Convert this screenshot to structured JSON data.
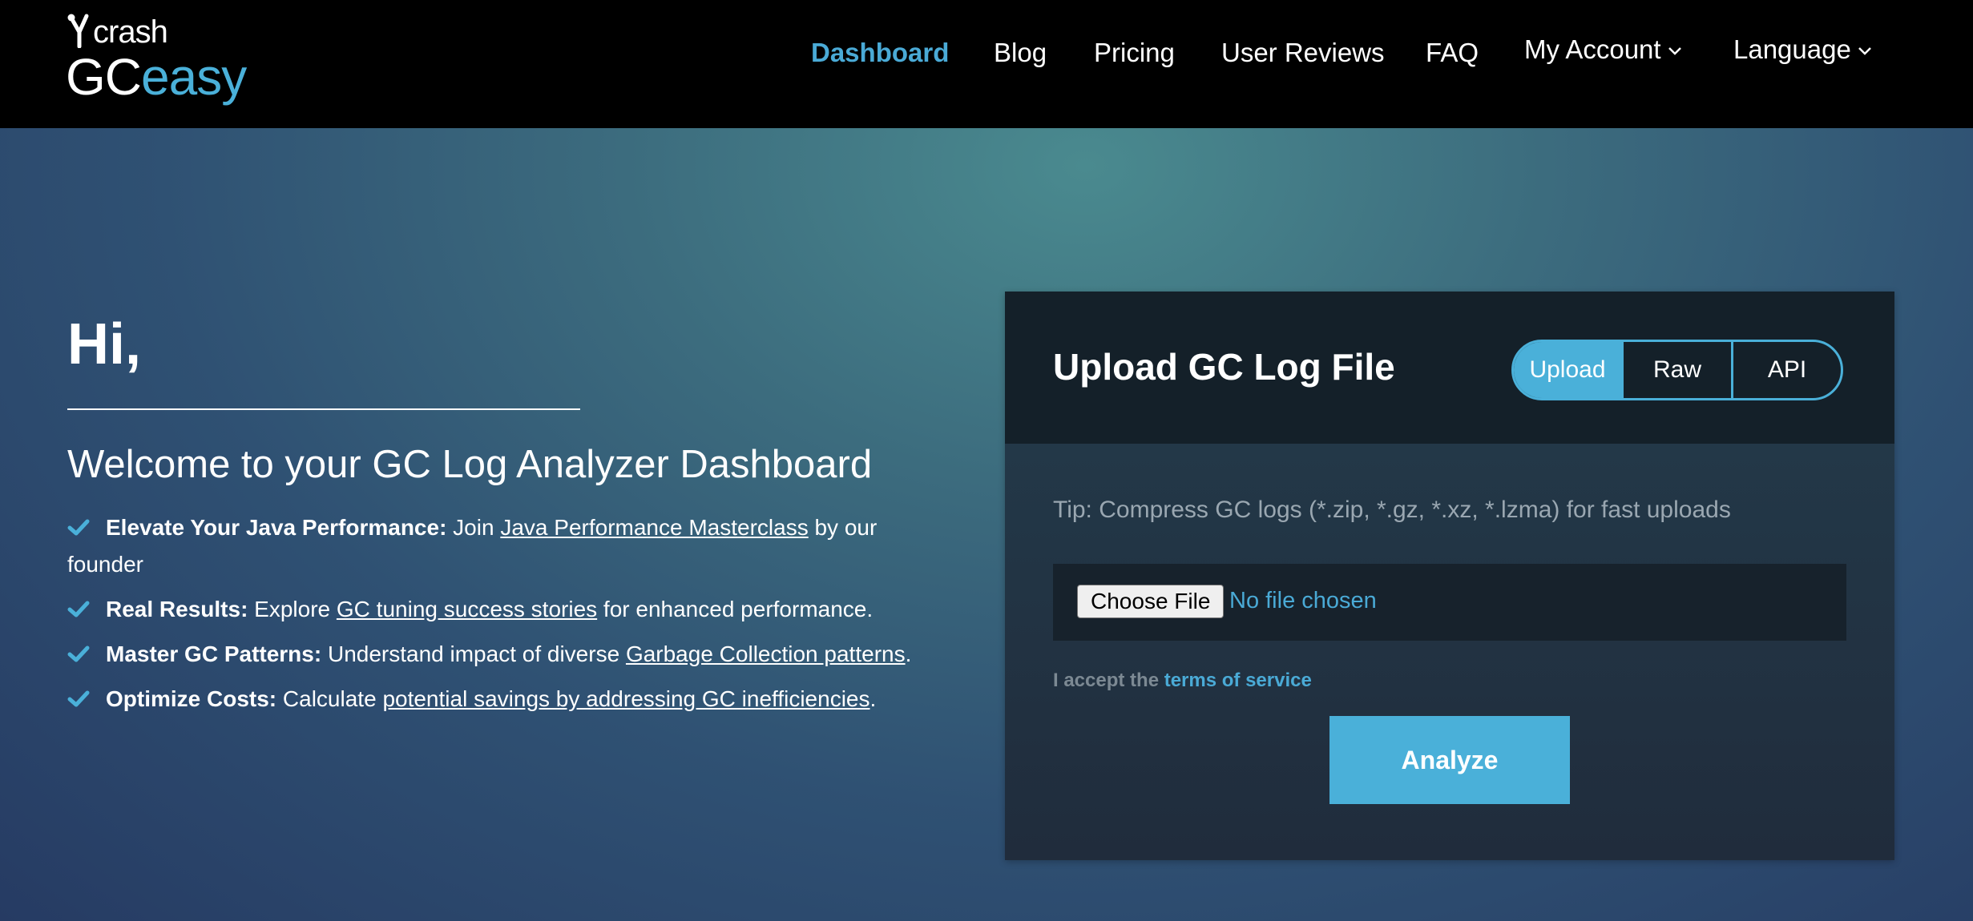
{
  "brand": {
    "top": "crash",
    "main_gc": "GC",
    "main_easy": "easy",
    "accent_color": "#4ab0d9"
  },
  "nav": {
    "items": [
      {
        "label": "Dashboard",
        "active": true
      },
      {
        "label": "Blog"
      },
      {
        "label": "Pricing"
      },
      {
        "label": "User Reviews"
      },
      {
        "label": "FAQ"
      },
      {
        "label": "My Account",
        "dropdown": true
      },
      {
        "label": "Language",
        "dropdown": true
      }
    ]
  },
  "hero": {
    "greeting": "Hi,",
    "welcome": "Welcome to your GC Log Analyzer Dashboard",
    "features": [
      {
        "bold": "Elevate Your Java Performance:",
        "before": " Join ",
        "link": "Java Performance Masterclass",
        "after": " by our",
        "after2": "founder"
      },
      {
        "bold": "Real Results:",
        "before": " Explore ",
        "link": "GC tuning success stories",
        "after": " for enhanced performance."
      },
      {
        "bold": "Master GC Patterns:",
        "before": " Understand impact of diverse ",
        "link": "Garbage Collection patterns",
        "after": "."
      },
      {
        "bold": "Optimize Costs:",
        "before": " Calculate ",
        "link": "potential savings by addressing GC inefficiencies",
        "after": "."
      }
    ]
  },
  "upload": {
    "title": "Upload GC Log File",
    "modes": [
      {
        "label": "Upload",
        "active": true
      },
      {
        "label": "Raw"
      },
      {
        "label": "API"
      }
    ],
    "tip": "Tip: Compress GC logs (*.zip, *.gz, *.xz, *.lzma) for fast uploads",
    "choose_file": "Choose File",
    "file_status": "No file chosen",
    "terms_prefix": "I accept the ",
    "terms_link": "terms of service",
    "analyze": "Analyze"
  }
}
